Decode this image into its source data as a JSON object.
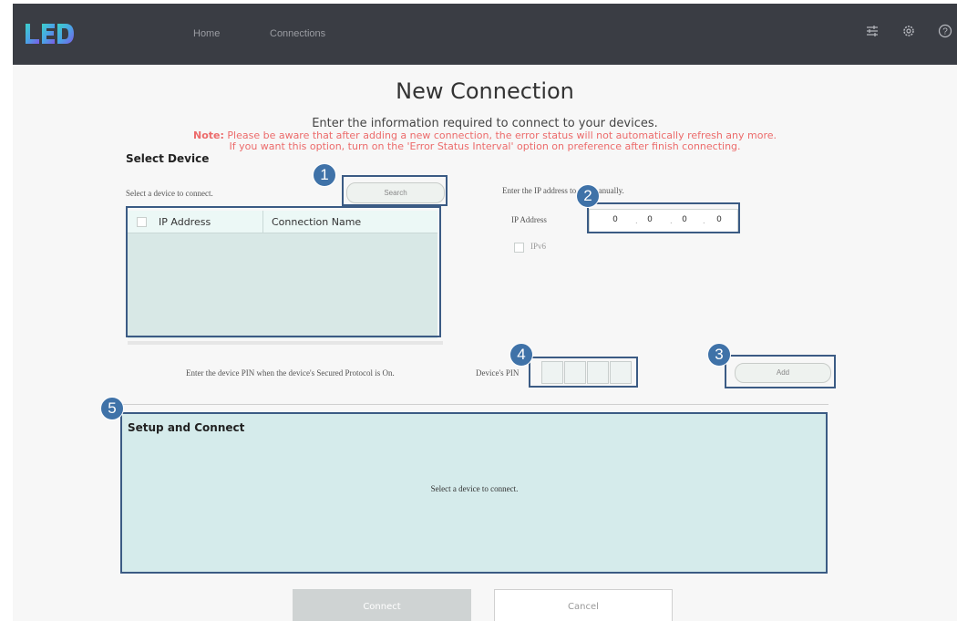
{
  "app": {
    "logo_text": "LED",
    "nav": [
      "Home",
      "Connections"
    ],
    "icons": [
      "sliders-icon",
      "gear-icon",
      "help-icon"
    ]
  },
  "page": {
    "title": "New Connection",
    "subtitle": "Enter the information required to connect to your devices.",
    "note_label": "Note:",
    "note_line1": " Please be aware that after adding a new connection, the error status will not automatically refresh any more.",
    "note_line2": "If you want this option, turn on the 'Error Status Interval' option on preference after finish connecting."
  },
  "select_device": {
    "title": "Select Device",
    "instruction": "Select a device to connect.",
    "search_label": "Search",
    "columns": [
      "IP Address",
      "Connection Name"
    ],
    "rows": []
  },
  "manual": {
    "instruction": "Enter the IP address to add manually.",
    "ip_label": "IP Address",
    "ip_octets": [
      "0",
      "0",
      "0",
      "0"
    ],
    "ipv6_label": "IPv6",
    "add_label": "Add"
  },
  "pin": {
    "instruction": "Enter the device PIN when the device's Secured Protocol is On.",
    "label": "Device's PIN"
  },
  "setup": {
    "title": "Setup and Connect",
    "message": "Select a device to connect."
  },
  "actions": {
    "connect_label": "Connect",
    "cancel_label": "Cancel"
  },
  "annotations": [
    "1",
    "2",
    "3",
    "4",
    "5"
  ],
  "colors": {
    "topbar": "#3a3d44",
    "note": "#ec6b6b",
    "highlight": "#3b5b84",
    "badge": "#3f72a8",
    "panel": "#d5ebeb"
  }
}
